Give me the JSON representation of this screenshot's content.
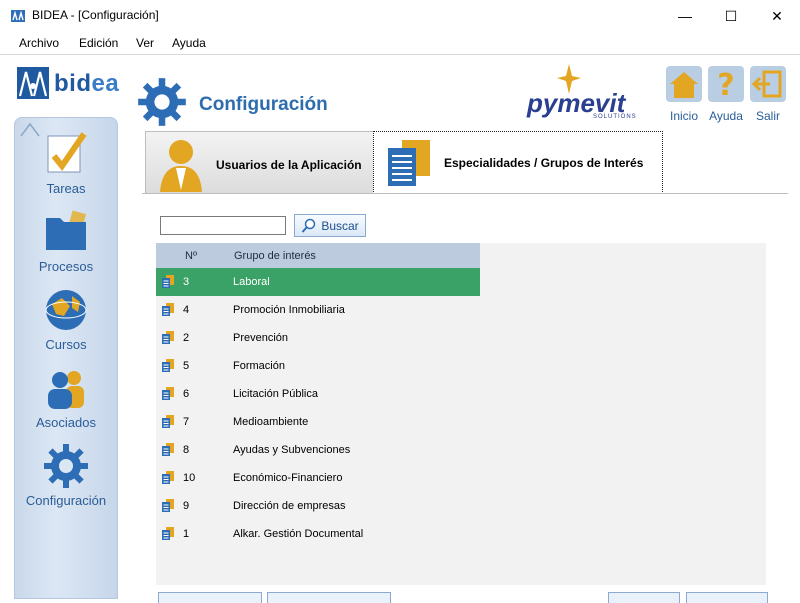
{
  "window": {
    "title": "BIDEA - [Configuración]",
    "minimize": "—",
    "maximize": "☐",
    "close": "✕"
  },
  "menu": [
    {
      "label": "Archivo"
    },
    {
      "label": "Edición"
    },
    {
      "label": "Ver"
    },
    {
      "label": "Ayuda"
    }
  ],
  "logo": {
    "text_a": "bid",
    "text_b": "ea"
  },
  "sidebar": {
    "items": [
      {
        "label": "Tareas",
        "icon": "checkmark-clipboard-icon"
      },
      {
        "label": "Procesos",
        "icon": "folder-icon"
      },
      {
        "label": "Cursos",
        "icon": "globe-icon"
      },
      {
        "label": "Asociados",
        "icon": "people-icon"
      },
      {
        "label": "Configuración",
        "icon": "gear-icon"
      }
    ]
  },
  "header": {
    "title": "Configuración",
    "brand": "pymevit",
    "brand_sub": "SOLUTIONS",
    "nav": [
      {
        "label": "Inicio",
        "icon": "home-icon"
      },
      {
        "label": "Ayuda",
        "icon": "help-icon"
      },
      {
        "label": "Salir",
        "icon": "exit-icon"
      }
    ]
  },
  "tabs": [
    {
      "label": "Usuarios de la Aplicación",
      "active": false
    },
    {
      "label": "Especialidades / Grupos de Interés",
      "active": true
    }
  ],
  "search": {
    "value": "",
    "button_label": "Buscar"
  },
  "table": {
    "columns": [
      "Nº",
      "Grupo de interés"
    ],
    "rows": [
      {
        "num": "3",
        "name": "Laboral",
        "selected": true
      },
      {
        "num": "4",
        "name": "Promoción Inmobiliaria",
        "selected": false
      },
      {
        "num": "2",
        "name": "Prevención",
        "selected": false
      },
      {
        "num": "5",
        "name": "Formación",
        "selected": false
      },
      {
        "num": "6",
        "name": "Licitación Pública",
        "selected": false
      },
      {
        "num": "7",
        "name": "Medioambiente",
        "selected": false
      },
      {
        "num": "8",
        "name": "Ayudas y Subvenciones",
        "selected": false
      },
      {
        "num": "10",
        "name": "Económico-Financiero",
        "selected": false
      },
      {
        "num": "9",
        "name": "Dirección de empresas",
        "selected": false
      },
      {
        "num": "1",
        "name": "Alkar. Gestión Documental",
        "selected": false
      }
    ]
  },
  "colors": {
    "selected_row": "#3aa266",
    "header_blue": "#2d6cae",
    "table_header": "#bccbde"
  }
}
